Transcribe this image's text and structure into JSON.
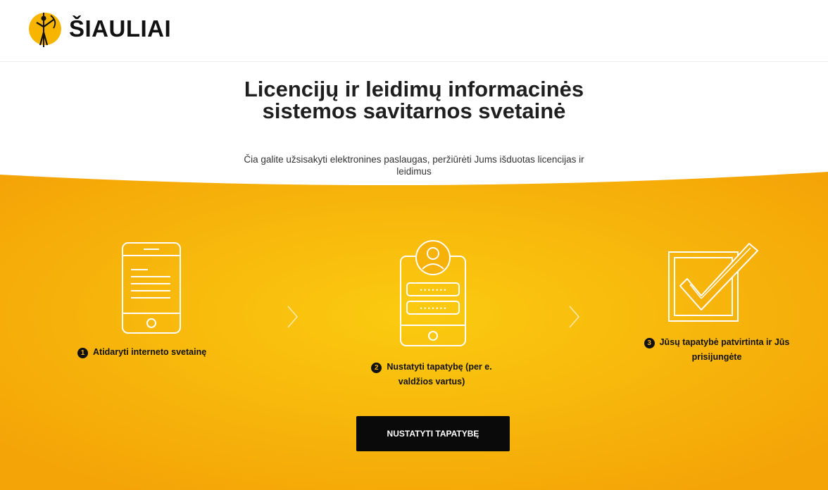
{
  "header": {
    "logo_text": "ŠIAULIAI"
  },
  "hero": {
    "title": "Licencijų ir leidimų informacinės sistemos savitarnos svetainė",
    "subtitle": "Čia galite užsisakyti elektronines paslaugas, peržiūrėti Jums išduotas licencijas ir leidimus"
  },
  "steps": [
    {
      "number": "1",
      "label": "Atidaryti interneto svetainę",
      "icon": "smartphone-icon"
    },
    {
      "number": "2",
      "label": "Nustatyti tapatybę (per e. valdžios vartus)",
      "icon": "login-form-icon"
    },
    {
      "number": "3",
      "label": "Jūsų tapatybė patvirtinta ir Jūs prisijungėte",
      "icon": "checkbox-checked-icon"
    }
  ],
  "cta": {
    "label": "NUSTATYTI TAPATYBĘ"
  },
  "colors": {
    "band_light": "#f9c40e",
    "band_dark": "#f4a407",
    "button": "#0a0a0a"
  }
}
